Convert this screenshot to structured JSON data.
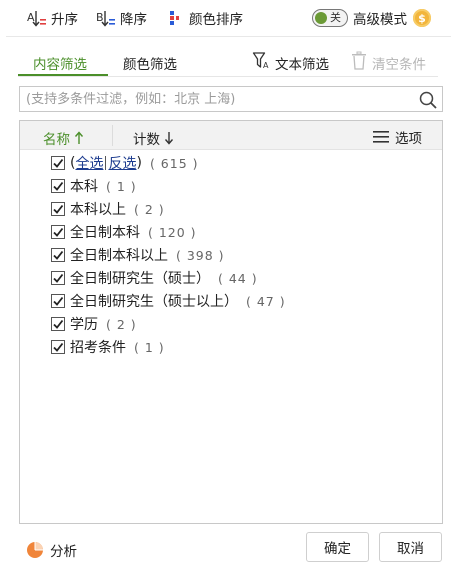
{
  "toolbar": {
    "sort_asc": "升序",
    "sort_desc": "降序",
    "color_sort": "颜色排序",
    "toggle_text": "关",
    "advanced_mode": "高级模式",
    "coin_symbol": "$"
  },
  "tabs": {
    "content_filter": "内容筛选",
    "color_filter": "颜色筛选",
    "text_filter": "文本筛选",
    "clear_conditions": "清空条件"
  },
  "search": {
    "placeholder": "(支持多条件过滤，例如：北京 上海)"
  },
  "list_header": {
    "name": "名称",
    "count": "计数",
    "options": "选项"
  },
  "select_row": {
    "open_paren": "(",
    "select_all": "全选",
    "invert": "反选",
    "close_paren": ")",
    "count": "( 615 )"
  },
  "items": [
    {
      "label": "本科",
      "count": "( 1 )"
    },
    {
      "label": "本科以上",
      "count": "( 2 )"
    },
    {
      "label": "全日制本科",
      "count": "( 120 )"
    },
    {
      "label": "全日制本科以上",
      "count": "( 398 )"
    },
    {
      "label": "全日制研究生（硕士）",
      "count": "( 44 )"
    },
    {
      "label": "全日制研究生（硕士以上）",
      "count": "( 47 )"
    },
    {
      "label": "学历",
      "count": "( 2 )"
    },
    {
      "label": "招考条件",
      "count": "( 1 )"
    }
  ],
  "footer": {
    "analyze": "分析",
    "ok": "确定",
    "cancel": "取消"
  },
  "colors": {
    "accent_green": "#4b8f2a",
    "link_blue": "#1d3c8f",
    "coin_gold": "#f2b53c",
    "chart_orange": "#f0853a"
  }
}
